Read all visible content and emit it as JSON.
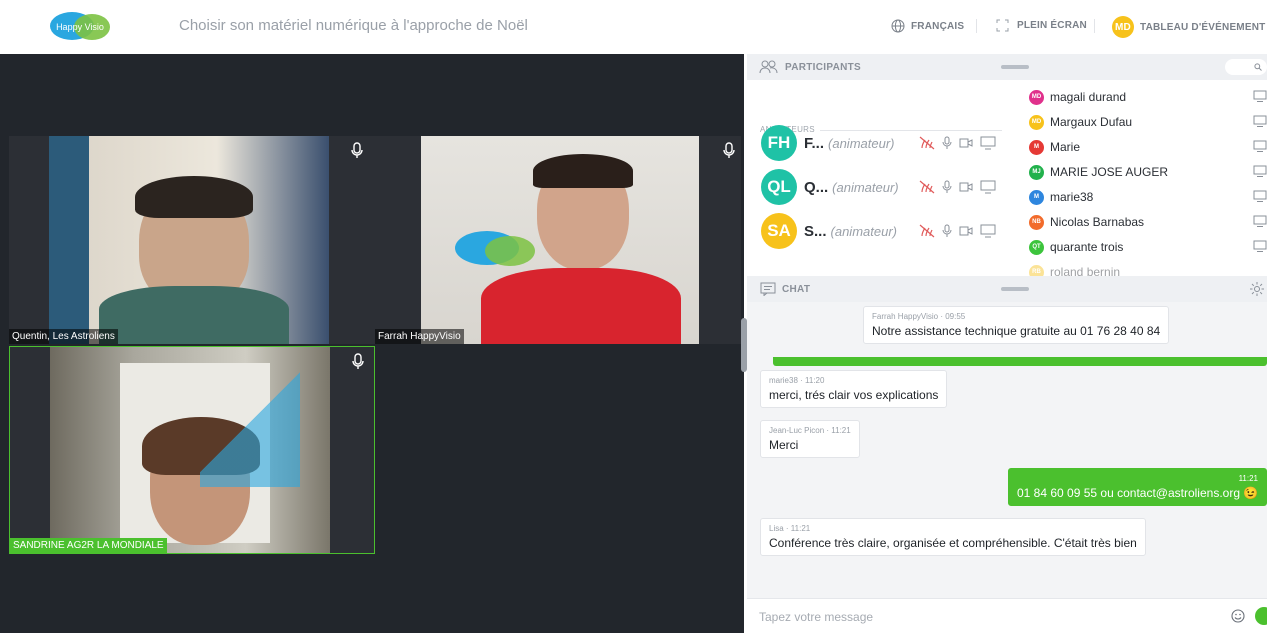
{
  "header": {
    "logo_text": "Happy Visio",
    "title": "Choisir son matériel numérique à l'approche de Noël",
    "language_label": "FRANÇAIS",
    "fullscreen_label": "PLEIN ÉCRAN",
    "dashboard_badge": "MD",
    "dashboard_label": "TABLEAU D'ÉVÉNEMENT"
  },
  "videos": [
    {
      "name": "Quentin, Les Astroliens"
    },
    {
      "name": "Farrah HappyVisio"
    },
    {
      "name": "SANDRINE AG2R LA MONDIALE"
    }
  ],
  "participants": {
    "heading": "PARTICIPANTS",
    "search_icon": "search-icon",
    "animators_label": "ANIMATEURS",
    "animators": [
      {
        "initials": "FH",
        "name": "F...",
        "role": "(animateur)",
        "color": "#1fc2a6"
      },
      {
        "initials": "QL",
        "name": "Q...",
        "role": "(animateur)",
        "color": "#1fc2a6"
      },
      {
        "initials": "SA",
        "name": "S...",
        "role": "(animateur)",
        "color": "#f7c21b"
      }
    ],
    "list": [
      {
        "initials": "MD",
        "name": "magali durand",
        "color": "#e0318c"
      },
      {
        "initials": "MD",
        "name": "Margaux Dufau",
        "color": "#f7c21b"
      },
      {
        "initials": "M",
        "name": "Marie",
        "color": "#e53935"
      },
      {
        "initials": "MJ",
        "name": "MARIE JOSE AUGER",
        "color": "#22b14c"
      },
      {
        "initials": "M",
        "name": "marie38",
        "color": "#2e86de"
      },
      {
        "initials": "NB",
        "name": "Nicolas Barnabas",
        "color": "#f26b2b"
      },
      {
        "initials": "QT",
        "name": "quarante trois",
        "color": "#3cc43c"
      },
      {
        "initials": "RB",
        "name": "roland bernin",
        "color": "#f7c21b"
      }
    ]
  },
  "chat": {
    "heading": "CHAT",
    "messages": [
      {
        "author": "Farrah HappyVisio",
        "time": "09:55",
        "text": "Notre assistance technique gratuite au 01 76 28 40 84"
      },
      {
        "author": "marie38",
        "time": "11:20",
        "text": "merci, trés clair vos explications"
      },
      {
        "author": "Jean-Luc Picon",
        "time": "11:21",
        "text": "Merci"
      },
      {
        "author": "",
        "time": "11:21",
        "text": "01 84 60 09 55 ou contact@astroliens.org 😉"
      },
      {
        "author": "Lisa",
        "time": "11:21",
        "text": "Conférence très claire, organisée et compréhensible. C'était très bien"
      }
    ],
    "input_placeholder": "Tapez votre message"
  },
  "colors": {
    "accent_green": "#4bc02e",
    "brand_blue": "#2aa7e0",
    "brand_green": "#7cc242"
  }
}
